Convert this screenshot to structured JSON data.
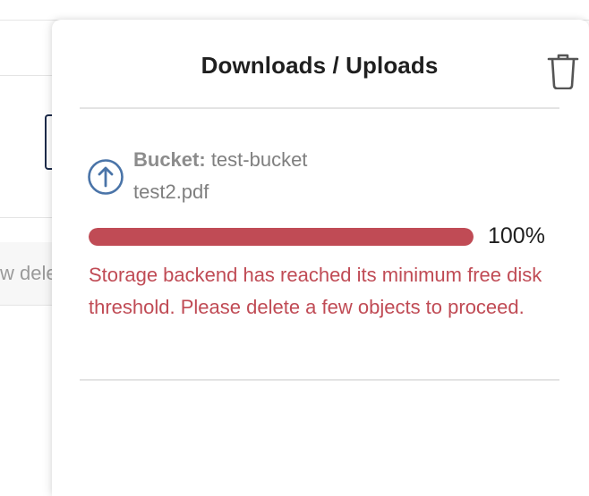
{
  "background": {
    "partial_text": "w dele"
  },
  "panel": {
    "title": "Downloads / Uploads",
    "trash_icon": "trash-icon"
  },
  "transfer": {
    "direction_icon": "upload-arrow-icon",
    "bucket_label": "Bucket:",
    "bucket_name": "test-bucket",
    "file_name": "test2.pdf",
    "progress": 1.0,
    "progress_text": "100%",
    "error": "Storage backend has reached its minimum free disk threshold. Please delete a few objects to proceed."
  },
  "colors": {
    "error": "#c04b55",
    "icon_blue": "#4a74a8",
    "title": "#1f1f1f"
  }
}
